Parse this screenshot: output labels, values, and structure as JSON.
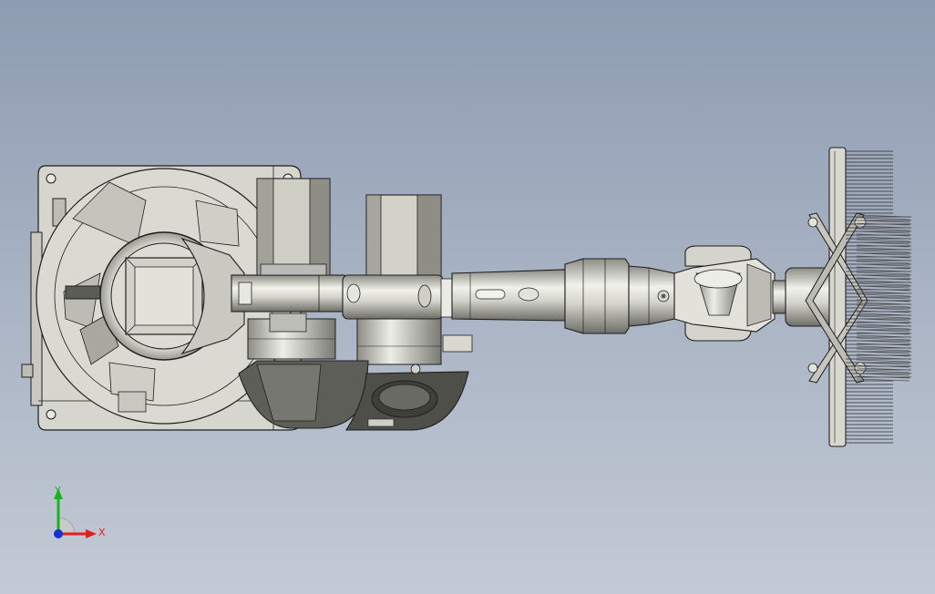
{
  "viewport": {
    "background_top": "#8e9cb1",
    "background_bottom": "#c3cad5"
  },
  "triad": {
    "x_label": "X",
    "y_label": "Y",
    "x_color": "#e0201c",
    "y_color": "#18b41e",
    "z_color": "#1630d8"
  },
  "model": {
    "body_color": "#d9d9d2",
    "shade_color": "#a8a8a0",
    "dark_color": "#5c5c56",
    "edge_color": "#1e1e1e"
  }
}
